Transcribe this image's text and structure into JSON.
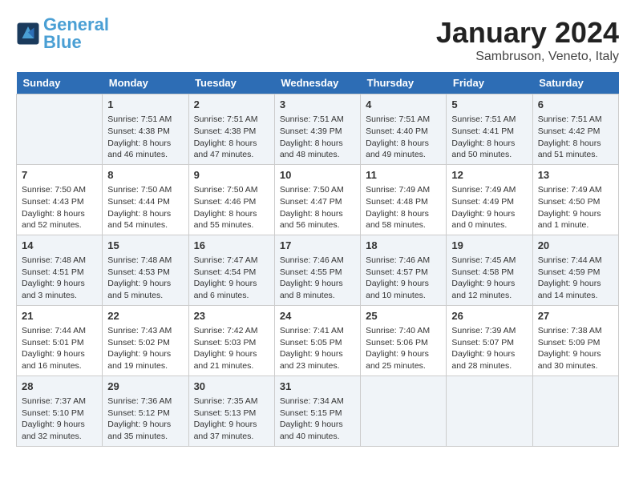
{
  "header": {
    "logo_line1": "General",
    "logo_line2": "Blue",
    "month": "January 2024",
    "location": "Sambruson, Veneto, Italy"
  },
  "days_of_week": [
    "Sunday",
    "Monday",
    "Tuesday",
    "Wednesday",
    "Thursday",
    "Friday",
    "Saturday"
  ],
  "weeks": [
    [
      {
        "day": "",
        "info": ""
      },
      {
        "day": "1",
        "info": "Sunrise: 7:51 AM\nSunset: 4:38 PM\nDaylight: 8 hours\nand 46 minutes."
      },
      {
        "day": "2",
        "info": "Sunrise: 7:51 AM\nSunset: 4:38 PM\nDaylight: 8 hours\nand 47 minutes."
      },
      {
        "day": "3",
        "info": "Sunrise: 7:51 AM\nSunset: 4:39 PM\nDaylight: 8 hours\nand 48 minutes."
      },
      {
        "day": "4",
        "info": "Sunrise: 7:51 AM\nSunset: 4:40 PM\nDaylight: 8 hours\nand 49 minutes."
      },
      {
        "day": "5",
        "info": "Sunrise: 7:51 AM\nSunset: 4:41 PM\nDaylight: 8 hours\nand 50 minutes."
      },
      {
        "day": "6",
        "info": "Sunrise: 7:51 AM\nSunset: 4:42 PM\nDaylight: 8 hours\nand 51 minutes."
      }
    ],
    [
      {
        "day": "7",
        "info": "Sunrise: 7:50 AM\nSunset: 4:43 PM\nDaylight: 8 hours\nand 52 minutes."
      },
      {
        "day": "8",
        "info": "Sunrise: 7:50 AM\nSunset: 4:44 PM\nDaylight: 8 hours\nand 54 minutes."
      },
      {
        "day": "9",
        "info": "Sunrise: 7:50 AM\nSunset: 4:46 PM\nDaylight: 8 hours\nand 55 minutes."
      },
      {
        "day": "10",
        "info": "Sunrise: 7:50 AM\nSunset: 4:47 PM\nDaylight: 8 hours\nand 56 minutes."
      },
      {
        "day": "11",
        "info": "Sunrise: 7:49 AM\nSunset: 4:48 PM\nDaylight: 8 hours\nand 58 minutes."
      },
      {
        "day": "12",
        "info": "Sunrise: 7:49 AM\nSunset: 4:49 PM\nDaylight: 9 hours\nand 0 minutes."
      },
      {
        "day": "13",
        "info": "Sunrise: 7:49 AM\nSunset: 4:50 PM\nDaylight: 9 hours\nand 1 minute."
      }
    ],
    [
      {
        "day": "14",
        "info": "Sunrise: 7:48 AM\nSunset: 4:51 PM\nDaylight: 9 hours\nand 3 minutes."
      },
      {
        "day": "15",
        "info": "Sunrise: 7:48 AM\nSunset: 4:53 PM\nDaylight: 9 hours\nand 5 minutes."
      },
      {
        "day": "16",
        "info": "Sunrise: 7:47 AM\nSunset: 4:54 PM\nDaylight: 9 hours\nand 6 minutes."
      },
      {
        "day": "17",
        "info": "Sunrise: 7:46 AM\nSunset: 4:55 PM\nDaylight: 9 hours\nand 8 minutes."
      },
      {
        "day": "18",
        "info": "Sunrise: 7:46 AM\nSunset: 4:57 PM\nDaylight: 9 hours\nand 10 minutes."
      },
      {
        "day": "19",
        "info": "Sunrise: 7:45 AM\nSunset: 4:58 PM\nDaylight: 9 hours\nand 12 minutes."
      },
      {
        "day": "20",
        "info": "Sunrise: 7:44 AM\nSunset: 4:59 PM\nDaylight: 9 hours\nand 14 minutes."
      }
    ],
    [
      {
        "day": "21",
        "info": "Sunrise: 7:44 AM\nSunset: 5:01 PM\nDaylight: 9 hours\nand 16 minutes."
      },
      {
        "day": "22",
        "info": "Sunrise: 7:43 AM\nSunset: 5:02 PM\nDaylight: 9 hours\nand 19 minutes."
      },
      {
        "day": "23",
        "info": "Sunrise: 7:42 AM\nSunset: 5:03 PM\nDaylight: 9 hours\nand 21 minutes."
      },
      {
        "day": "24",
        "info": "Sunrise: 7:41 AM\nSunset: 5:05 PM\nDaylight: 9 hours\nand 23 minutes."
      },
      {
        "day": "25",
        "info": "Sunrise: 7:40 AM\nSunset: 5:06 PM\nDaylight: 9 hours\nand 25 minutes."
      },
      {
        "day": "26",
        "info": "Sunrise: 7:39 AM\nSunset: 5:07 PM\nDaylight: 9 hours\nand 28 minutes."
      },
      {
        "day": "27",
        "info": "Sunrise: 7:38 AM\nSunset: 5:09 PM\nDaylight: 9 hours\nand 30 minutes."
      }
    ],
    [
      {
        "day": "28",
        "info": "Sunrise: 7:37 AM\nSunset: 5:10 PM\nDaylight: 9 hours\nand 32 minutes."
      },
      {
        "day": "29",
        "info": "Sunrise: 7:36 AM\nSunset: 5:12 PM\nDaylight: 9 hours\nand 35 minutes."
      },
      {
        "day": "30",
        "info": "Sunrise: 7:35 AM\nSunset: 5:13 PM\nDaylight: 9 hours\nand 37 minutes."
      },
      {
        "day": "31",
        "info": "Sunrise: 7:34 AM\nSunset: 5:15 PM\nDaylight: 9 hours\nand 40 minutes."
      },
      {
        "day": "",
        "info": ""
      },
      {
        "day": "",
        "info": ""
      },
      {
        "day": "",
        "info": ""
      }
    ]
  ]
}
